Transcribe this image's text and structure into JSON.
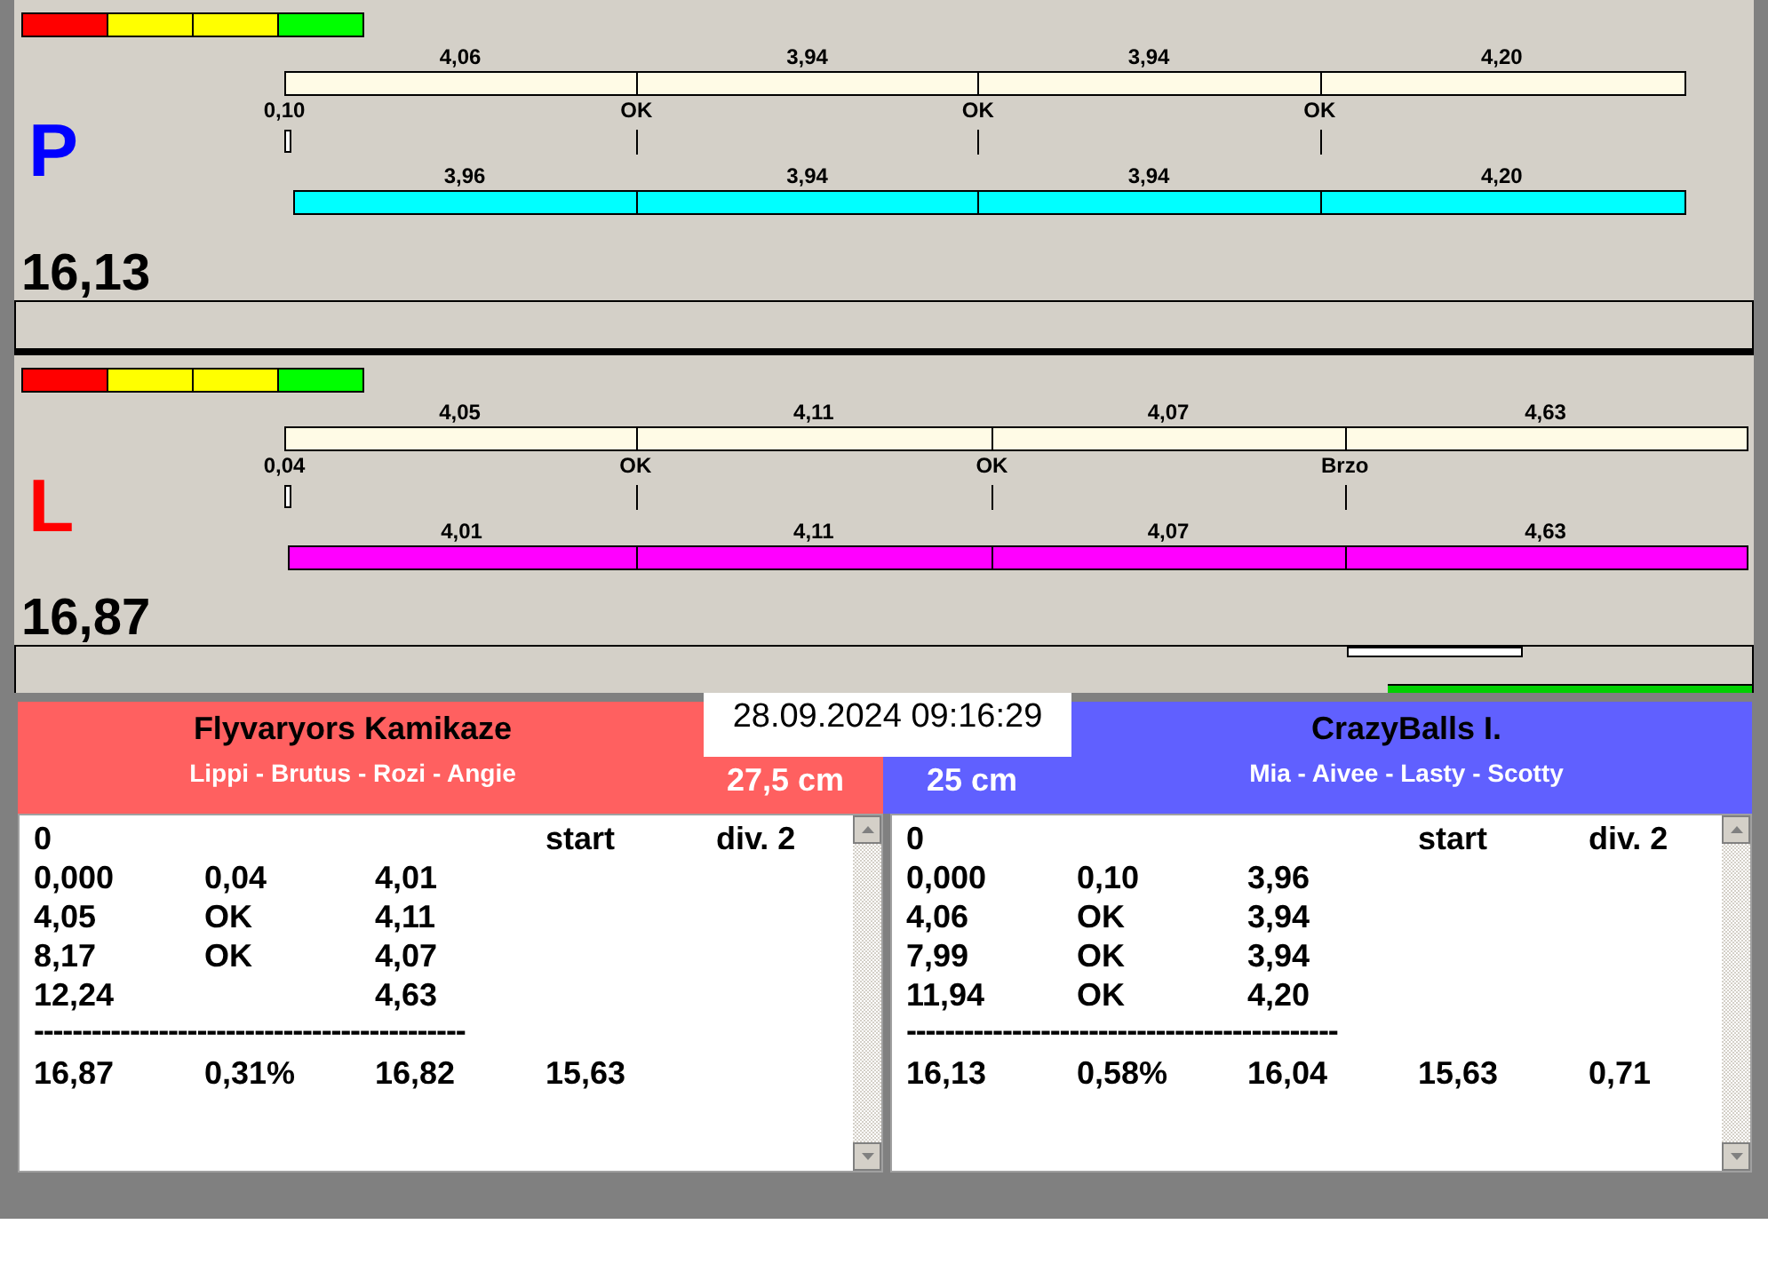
{
  "lanes": [
    {
      "letter": "P",
      "color": "#0000ff",
      "status_strip": [
        {
          "color": "#ff0000"
        },
        {
          "color": "#ffff00"
        },
        {
          "color": "#ffff00"
        },
        {
          "color": "#00ff00"
        }
      ],
      "split_bar": [
        "4,06",
        "3,94",
        "3,94",
        "4,20"
      ],
      "markers": [
        "0,10",
        "OK",
        "OK",
        "OK"
      ],
      "time_bar": {
        "color": "#00ffff",
        "segments": [
          "3,96",
          "3,94",
          "3,94",
          "4,20"
        ]
      },
      "total": "16,13",
      "progress_indicators": false
    },
    {
      "letter": "L",
      "color": "#ff0000",
      "status_strip": [
        {
          "color": "#ff0000"
        },
        {
          "color": "#ffff00"
        },
        {
          "color": "#ffff00"
        },
        {
          "color": "#00ff00"
        }
      ],
      "split_bar": [
        "4,05",
        "4,11",
        "4,07",
        "4,63"
      ],
      "markers": [
        "0,04",
        "OK",
        "OK",
        "Brzo"
      ],
      "time_bar": {
        "color": "#ff00ff",
        "segments": [
          "4,01",
          "4,11",
          "4,07",
          "4,63"
        ]
      },
      "total": "16,87",
      "progress_indicators": true
    }
  ],
  "timestamp": "28.09.2024 09:16:29",
  "teams": [
    {
      "name": "Flyvaryors Kamikaze",
      "members": "Lippi - Brutus - Rozi - Angie",
      "distance": "27,5 cm",
      "color": "#ff6060",
      "rows": [
        [
          "0",
          null,
          null,
          "start",
          "div. 2"
        ],
        [
          "0,000",
          "0,04",
          "4,01"
        ],
        [
          "4,05",
          "OK",
          "4,11"
        ],
        [
          "8,17",
          "OK",
          "4,07"
        ],
        [
          "12,24",
          null,
          "4,63"
        ]
      ],
      "separator": "---------------------------------------------",
      "summary": [
        "16,87",
        "0,31%",
        "16,82",
        "15,63"
      ]
    },
    {
      "name": "CrazyBalls I.",
      "members": "Mia - Aivee - Lasty - Scotty",
      "distance": "25 cm",
      "color": "#6060ff",
      "rows": [
        [
          "0",
          null,
          null,
          "start",
          "div. 2"
        ],
        [
          "0,000",
          "0,10",
          "3,96"
        ],
        [
          "4,06",
          "OK",
          "3,94"
        ],
        [
          "7,99",
          "OK",
          "3,94"
        ],
        [
          "11,94",
          "OK",
          "4,20"
        ]
      ],
      "separator": "---------------------------------------------",
      "summary": [
        "16,13",
        "0,58%",
        "16,04",
        "15,63",
        "0,71"
      ]
    }
  ]
}
